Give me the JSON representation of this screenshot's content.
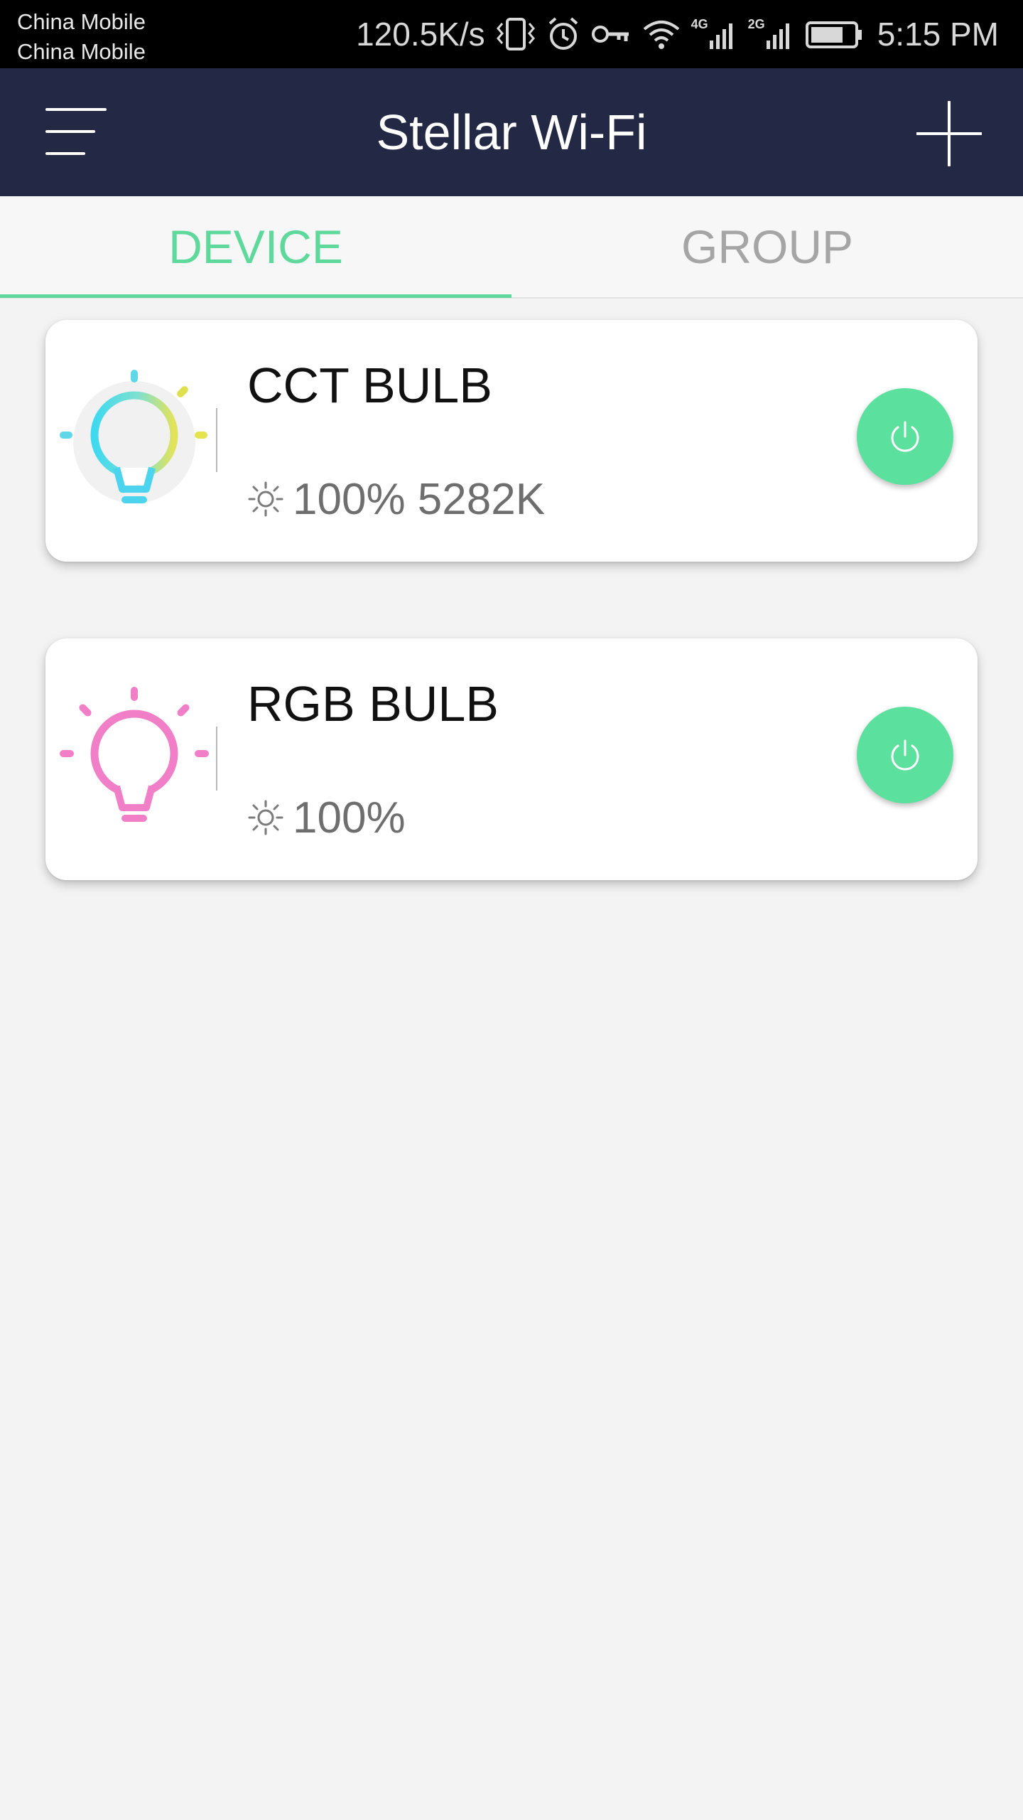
{
  "status_bar": {
    "carrier_1": "China Mobile",
    "carrier_2": "China Mobile",
    "net_speed": "120.5K/s",
    "net_4g": "4G",
    "net_2g": "2G",
    "time": "5:15 PM",
    "icons": [
      "vibrate-icon",
      "alarm-icon",
      "vpn-key-icon",
      "wifi-icon",
      "signal-4g-icon",
      "signal-2g-icon",
      "battery-icon"
    ]
  },
  "app_bar": {
    "title": "Stellar Wi-Fi",
    "menu_icon": "menu-icon",
    "add_icon": "plus-icon"
  },
  "tabs": [
    {
      "label": "DEVICE",
      "active": true
    },
    {
      "label": "GROUP",
      "active": false
    }
  ],
  "devices": [
    {
      "name": "CCT BULB",
      "status": "100% 5282K",
      "icon": "cct-bulb-icon",
      "power_icon": "power-icon"
    },
    {
      "name": "RGB BULB",
      "status": "100%",
      "icon": "rgb-bulb-icon",
      "power_icon": "power-icon"
    }
  ],
  "colors": {
    "app_bar": "#232845",
    "accent": "#5ed99b",
    "power_button": "#5ce09e",
    "rgb_bulb": "#f07fc8",
    "background": "#f3f3f3"
  }
}
